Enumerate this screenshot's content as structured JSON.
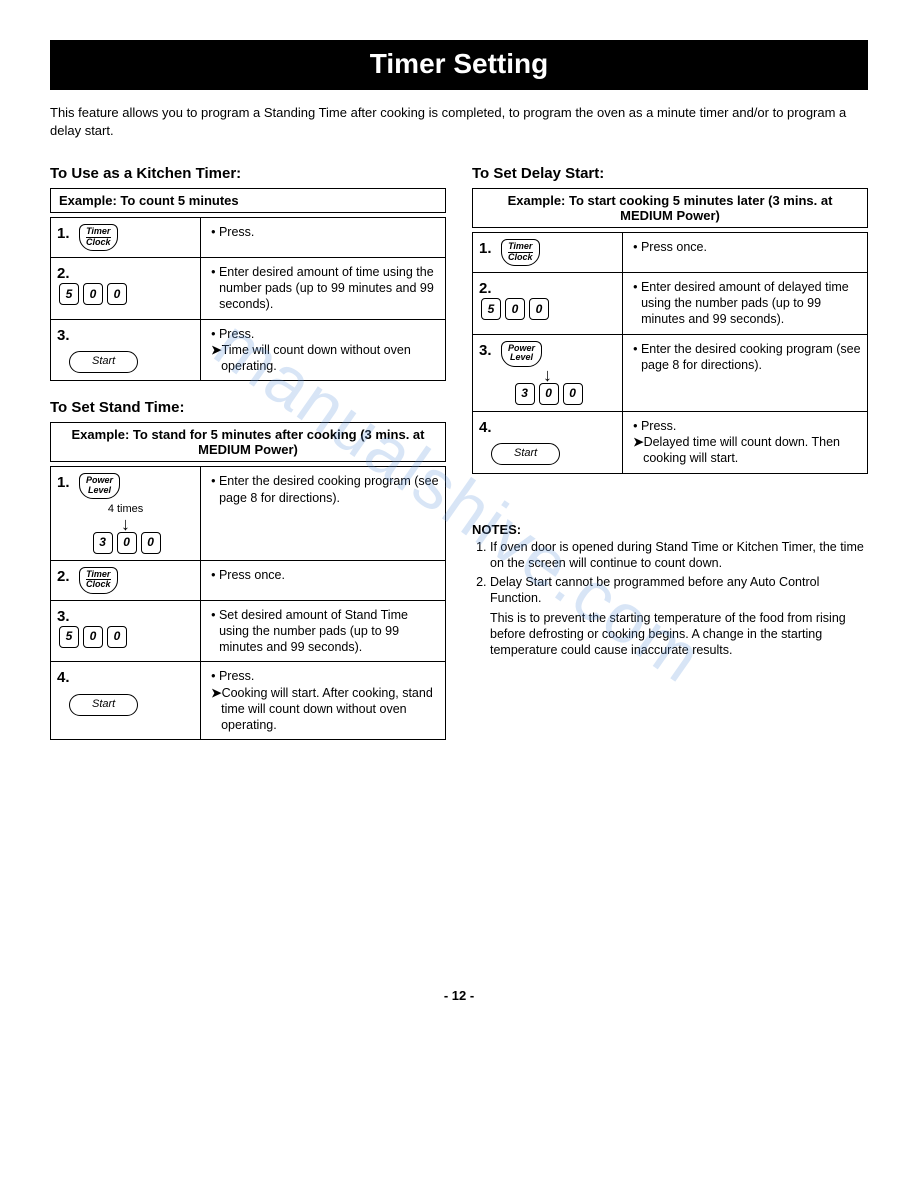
{
  "title": "Timer Setting",
  "intro": "This feature allows you to program a Standing Time after cooking is completed, to program the oven as a minute timer and/or to program a delay start.",
  "watermark": "manualshive.com",
  "page_number": "- 12 -",
  "buttons": {
    "timer_top": "Timer",
    "timer_bottom": "Clock",
    "power_top": "Power",
    "power_bottom": "Level",
    "start": "Start"
  },
  "kitchen_timer": {
    "title": "To Use as a Kitchen Timer:",
    "example": "Example:  To count 5 minutes",
    "steps": [
      {
        "num": "1.",
        "pad": null,
        "btn": "timer",
        "desc_bullet": "Press."
      },
      {
        "num": "2.",
        "pad": [
          "5",
          "0",
          "0"
        ],
        "desc_bullet": "Enter desired amount of time using the number pads (up to 99 minutes and 99 seconds)."
      },
      {
        "num": "3.",
        "btn": "start",
        "desc_bullet": "Press.",
        "desc_arrow": "Time will count down without oven operating."
      }
    ]
  },
  "stand_time": {
    "title": "To Set Stand Time:",
    "example": "Example:  To stand for 5 minutes after cooking (3 mins. at MEDIUM Power)",
    "steps": [
      {
        "num": "1.",
        "btn": "power",
        "sub": "4 times",
        "pad": [
          "3",
          "0",
          "0"
        ],
        "desc_bullet": "Enter the desired cooking program (see page 8 for directions)."
      },
      {
        "num": "2.",
        "btn": "timer",
        "desc_bullet": "Press once."
      },
      {
        "num": "3.",
        "pad": [
          "5",
          "0",
          "0"
        ],
        "desc_bullet": "Set desired amount of Stand Time using the  number pads (up to 99 minutes and 99 seconds)."
      },
      {
        "num": "4.",
        "btn": "start",
        "desc_bullet": "Press.",
        "desc_arrow": "Cooking will start. After cooking, stand time will count down without oven operating."
      }
    ]
  },
  "delay_start": {
    "title": "To Set Delay Start:",
    "example": "Example:  To start cooking 5 minutes later (3 mins. at MEDIUM Power)",
    "steps": [
      {
        "num": "1.",
        "btn": "timer",
        "desc_bullet": "Press once."
      },
      {
        "num": "2.",
        "pad": [
          "5",
          "0",
          "0"
        ],
        "desc_bullet": "Enter desired amount of delayed time using the number pads (up to 99 minutes and 99 seconds)."
      },
      {
        "num": "3.",
        "btn": "power",
        "pad": [
          "3",
          "0",
          "0"
        ],
        "desc_bullet": "Enter the desired cooking program (see page 8 for directions)."
      },
      {
        "num": "4.",
        "btn": "start",
        "desc_bullet": "Press.",
        "desc_arrow": "Delayed time will count down. Then cooking will start."
      }
    ]
  },
  "notes": {
    "title": "NOTES:",
    "items": [
      "If oven door is opened during Stand Time or Kitchen Timer, the time on the screen will continue to count down.",
      "Delay Start cannot be programmed before any Auto Control Function."
    ],
    "extra": "This is to prevent the starting temperature of the food from rising before defrosting or cooking begins. A change in the starting temperature could cause inaccurate results."
  }
}
